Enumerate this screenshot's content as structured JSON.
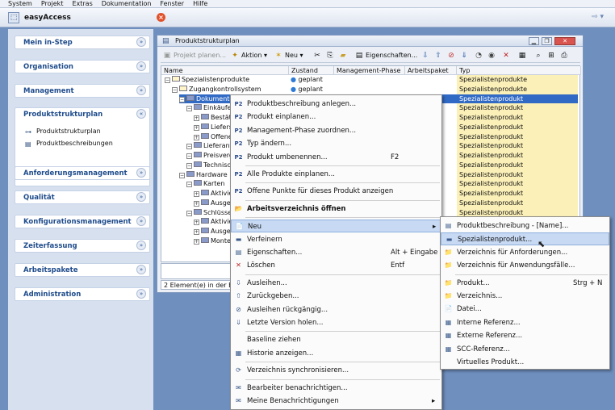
{
  "menubar": [
    "System",
    "Projekt",
    "Extras",
    "Dokumentation",
    "Fenster",
    "Hilfe"
  ],
  "app": {
    "title": "easyAccess",
    "icon": "app-logo-icon",
    "title_arrows": "⇨ ▾"
  },
  "sidebar": {
    "items_top": [
      {
        "label": "Mein in-Step"
      },
      {
        "label": "Organisation"
      },
      {
        "label": "Management"
      }
    ],
    "open_group": {
      "label": "Produktstrukturplan",
      "subitems": [
        "Produktstrukturplan",
        "Produktbeschreibungen"
      ]
    },
    "items_bottom": [
      {
        "label": "Anforderungsmanagement"
      },
      {
        "label": "Qualität"
      },
      {
        "label": "Konfigurationsmanagement"
      },
      {
        "label": "Zeiterfassung"
      },
      {
        "label": "Arbeitspakete"
      },
      {
        "label": "Administration"
      }
    ]
  },
  "window": {
    "title": "Produktstrukturplan",
    "toolbar": {
      "plan": "Projekt planen...",
      "aktion": "Aktion",
      "neu": "Neu",
      "eigenschaften": "Eigenschaften..."
    },
    "columns": [
      "Name",
      "Zustand",
      "Management-Phase",
      "Arbeitspaket",
      "Typ"
    ],
    "rows": [
      {
        "name": "Spezialistenprodukte",
        "zustand": "geplant",
        "typ": "Spezialistenprodukte",
        "indent": 0
      },
      {
        "name": "Zugangkontrollsystem",
        "zustand": "geplant",
        "typ": "Spezialistenprodukte",
        "indent": 1
      },
      {
        "name": "Dokumente",
        "zustand": "",
        "typ": "Spezialistenprodukt",
        "indent": 2
      },
      {
        "name": "Einkäufe",
        "zustand": "",
        "typ": "Spezialistenprodukt",
        "indent": 3
      },
      {
        "name": "Bestät",
        "zustand": "",
        "typ": "Spezialistenprodukt",
        "indent": 4
      },
      {
        "name": "Liefers",
        "zustand": "",
        "typ": "Spezialistenprodukt",
        "indent": 4
      },
      {
        "name": "Offene",
        "zustand": "",
        "typ": "Spezialistenprodukt",
        "indent": 4
      },
      {
        "name": "Lieferant",
        "zustand": "",
        "typ": "Spezialistenprodukt",
        "indent": 3
      },
      {
        "name": "Preisverg",
        "zustand": "",
        "typ": "Spezialistenprodukt",
        "indent": 3
      },
      {
        "name": "Technisc",
        "zustand": "",
        "typ": "Spezialistenprodukt",
        "indent": 3
      },
      {
        "name": "Hardware",
        "zustand": "",
        "typ": "Spezialistenprodukt",
        "indent": 2
      },
      {
        "name": "Karten",
        "zustand": "",
        "typ": "Spezialistenprodukt",
        "indent": 3
      },
      {
        "name": "Aktivie",
        "zustand": "",
        "typ": "Spezialistenprodukt",
        "indent": 4
      },
      {
        "name": "Ausge",
        "zustand": "",
        "typ": "Spezialistenprodukt",
        "indent": 4
      },
      {
        "name": "Schlüsse",
        "zustand": "",
        "typ": "Spezialistenprodukt",
        "indent": 3
      },
      {
        "name": "Aktivie",
        "zustand": "",
        "typ": "Spezialistenprodukt",
        "indent": 4
      },
      {
        "name": "Ausge",
        "zustand": "",
        "typ": "Spezialistenprodukt",
        "indent": 4
      },
      {
        "name": "Monte",
        "zustand": "",
        "typ": "Spezialistenprodukt",
        "indent": 4
      }
    ],
    "status": "2 Element(e) in der Ebene"
  },
  "context_menu": {
    "items": [
      {
        "label": "Produktbeschreibung anlegen...",
        "icon": "P2",
        "sc": ""
      },
      {
        "label": "Produkt einplanen...",
        "icon": "P2",
        "sc": ""
      },
      {
        "label": "Management-Phase zuordnen...",
        "icon": "P2",
        "sc": ""
      },
      {
        "label": "Typ ändern...",
        "icon": "P2",
        "sc": ""
      },
      {
        "label": "Produkt umbenennen...",
        "icon": "P2",
        "sc": "F2"
      },
      {
        "sep": true
      },
      {
        "label": "Alle Produkte einplanen...",
        "icon": "P2",
        "sc": ""
      },
      {
        "sep": true
      },
      {
        "label": "Offene Punkte für dieses Produkt anzeigen",
        "icon": "P2",
        "sc": ""
      },
      {
        "sep": true
      },
      {
        "label": "Arbeitsverzeichnis öffnen",
        "icon": "📂",
        "sc": "",
        "bold": true
      },
      {
        "sep": true
      },
      {
        "label": "Neu",
        "icon": "📄",
        "sc": "",
        "hl": true,
        "arrow": "▸"
      },
      {
        "label": "Verfeinern",
        "icon": "▬",
        "sc": ""
      },
      {
        "label": "Eigenschaften...",
        "icon": "▤",
        "sc": "Alt + Eingabe"
      },
      {
        "label": "Löschen",
        "icon": "✕",
        "sc": "Entf"
      },
      {
        "sep": true
      },
      {
        "label": "Ausleihen...",
        "icon": "⇩",
        "sc": ""
      },
      {
        "label": "Zurückgeben...",
        "icon": "⇧",
        "sc": ""
      },
      {
        "label": "Ausleihen rückgängig...",
        "icon": "⊘",
        "sc": ""
      },
      {
        "label": "Letzte Version holen...",
        "icon": "⇓",
        "sc": ""
      },
      {
        "sep": true
      },
      {
        "label": "Baseline ziehen",
        "icon": "",
        "sc": ""
      },
      {
        "label": "Historie anzeigen...",
        "icon": "▦",
        "sc": ""
      },
      {
        "sep": true
      },
      {
        "label": "Verzeichnis synchronisieren...",
        "icon": "⟳",
        "sc": ""
      },
      {
        "sep": true
      },
      {
        "label": "Bearbeiter benachrichtigen...",
        "icon": "✉",
        "sc": ""
      },
      {
        "label": "Meine Benachrichtigungen",
        "icon": "✉",
        "sc": "",
        "arrow": "▸"
      }
    ]
  },
  "submenu": {
    "items": [
      {
        "label": "Produktbeschreibung - [Name]...",
        "icon": "▤",
        "sc": ""
      },
      {
        "label": "Spezialistenprodukt...",
        "icon": "▬",
        "sc": "",
        "hl": true
      },
      {
        "label": "Verzeichnis für Anforderungen...",
        "icon": "📁",
        "sc": ""
      },
      {
        "label": "Verzeichnis für Anwendungsfälle...",
        "icon": "📁",
        "sc": ""
      },
      {
        "sep": true
      },
      {
        "label": "Produkt...",
        "icon": "📁",
        "sc": "Strg + N"
      },
      {
        "label": "Verzeichnis...",
        "icon": "📁",
        "sc": ""
      },
      {
        "label": "Datei...",
        "icon": "📄",
        "sc": ""
      },
      {
        "label": "Interne Referenz...",
        "icon": "▦",
        "sc": ""
      },
      {
        "label": "Externe Referenz...",
        "icon": "▦",
        "sc": ""
      },
      {
        "label": "SCC-Referenz...",
        "icon": "▦",
        "sc": ""
      },
      {
        "label": "Virtuelles Produkt...",
        "icon": "",
        "sc": ""
      }
    ]
  }
}
